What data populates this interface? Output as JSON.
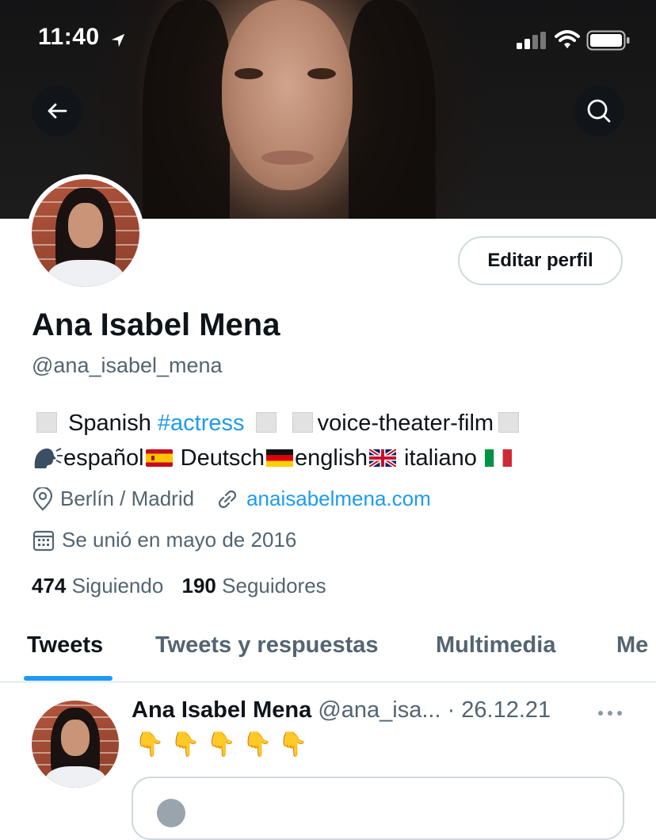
{
  "status_bar": {
    "time": "11:40"
  },
  "profile": {
    "name": "Ana Isabel Mena",
    "handle": "@ana_isabel_mena",
    "edit_button": "Editar perfil",
    "bio": {
      "line1_a": "Spanish ",
      "line1_hashtag": "#actress",
      "line1_b": "voice-theater-film",
      "line2_a": "español",
      "line2_b": " Deutsch",
      "line2_c": "english",
      "line2_d": " italiano "
    },
    "location": "Berlín / Madrid",
    "website": "anaisabelmena.com",
    "joined": "Se unió en mayo de 2016",
    "following_count": "474",
    "following_label": "Siguiendo",
    "followers_count": "190",
    "followers_label": "Seguidores"
  },
  "tabs": [
    {
      "label": "Tweets",
      "active": true
    },
    {
      "label": "Tweets y respuestas",
      "active": false
    },
    {
      "label": "Multimedia",
      "active": false
    },
    {
      "label": "Me",
      "active": false
    }
  ],
  "tweet": {
    "name": "Ana Isabel Mena",
    "handle": "@ana_isa...",
    "date": "· 26.12.21",
    "text": "👇👇👇👇👇"
  },
  "colors": {
    "accent": "#1d9bf0",
    "text": "#0f1419",
    "muted": "#536471",
    "border": "#cfd9de"
  },
  "icons": [
    "location-arrow-icon",
    "signal-icon",
    "wifi-icon",
    "battery-icon",
    "back-arrow-icon",
    "search-icon",
    "location-pin-icon",
    "link-icon",
    "calendar-icon",
    "more-icon"
  ]
}
